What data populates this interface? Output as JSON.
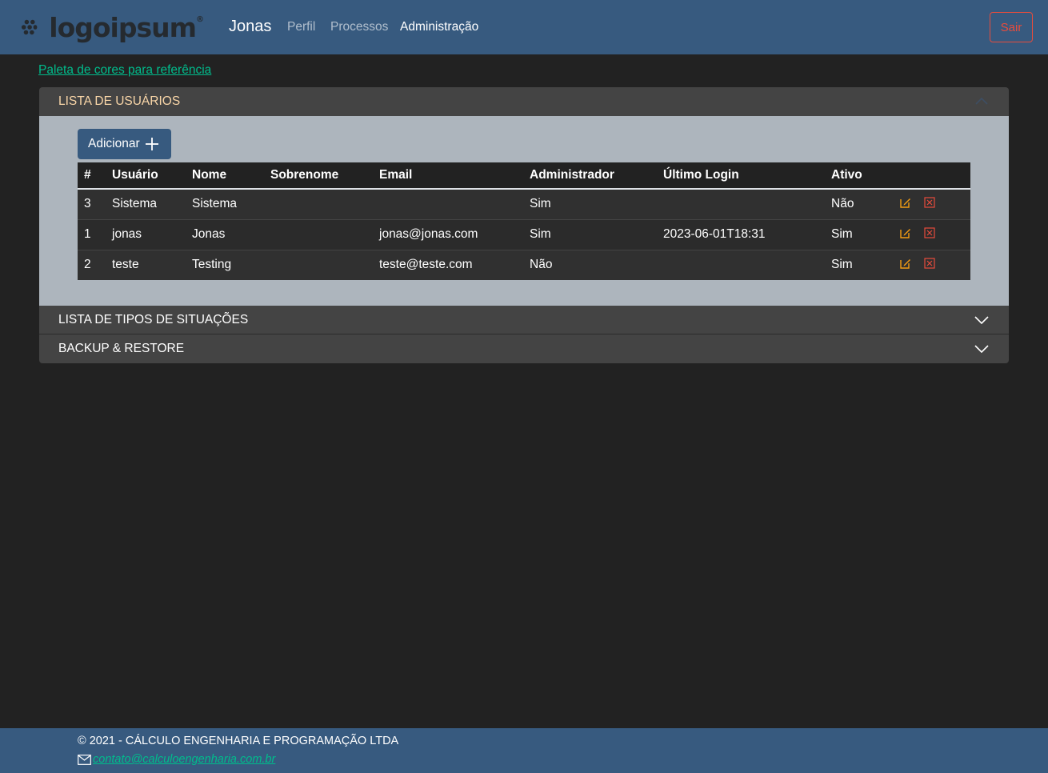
{
  "navbar": {
    "logo_text": "logoipsum",
    "user_name": "Jonas",
    "links": [
      {
        "label": "Perfil",
        "active": false
      },
      {
        "label": "Processos",
        "active": false
      },
      {
        "label": "Administração",
        "active": true
      }
    ],
    "logout_label": "Sair"
  },
  "palette_link": "Paleta de cores para referência",
  "sections": [
    {
      "title": "LISTA DE USUÁRIOS",
      "expanded": true,
      "icon": "chevron-up-icon"
    },
    {
      "title": "LISTA DE TIPOS DE SITUAÇÕES",
      "expanded": false,
      "icon": "chevron-down-icon"
    },
    {
      "title": "BACKUP & RESTORE",
      "expanded": false,
      "icon": "chevron-down-icon"
    }
  ],
  "users": {
    "add_label": "Adicionar",
    "columns": [
      "#",
      "Usuário",
      "Nome",
      "Sobrenome",
      "Email",
      "Administrador",
      "Último Login",
      "Ativo",
      ""
    ],
    "rows": [
      [
        "3",
        "Sistema",
        "Sistema",
        "",
        "",
        "Sim",
        "",
        "Não"
      ],
      [
        "1",
        "jonas",
        "Jonas",
        "",
        "jonas@jonas.com",
        "Sim",
        "2023-06-01T18:31",
        "Sim"
      ],
      [
        "2",
        "teste",
        "Testing",
        "",
        "teste@teste.com",
        "Não",
        "",
        "Sim"
      ]
    ],
    "row_actions": [
      "edit-icon",
      "delete-icon"
    ]
  },
  "footer": {
    "copyright": "© 2021 - CÁLCULO ENGENHARIA E PROGRAMAÇÃO LTDA",
    "email": "contato@calculoengenharia.com.br"
  },
  "colors": {
    "primary": "#375a7f",
    "background": "#222222",
    "success": "#00bc8c",
    "danger": "#e74c3c",
    "warning": "#f39c12",
    "panel": "#adb5bd"
  }
}
